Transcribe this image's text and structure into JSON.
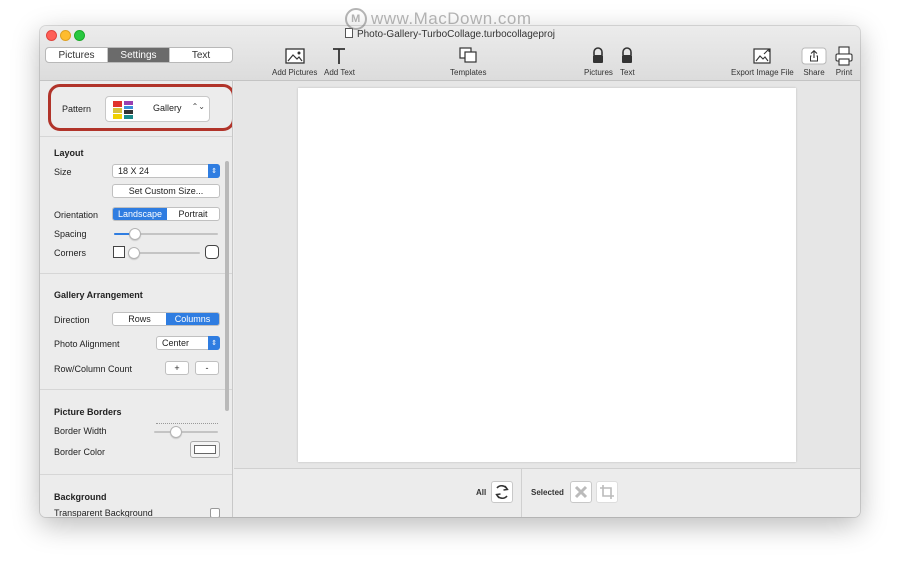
{
  "watermark": {
    "text": "www.MacDown.com",
    "logo": "M"
  },
  "window": {
    "title": "Photo-Gallery-TurboCollage.turbocollageproj"
  },
  "tabs": [
    {
      "label": "Pictures"
    },
    {
      "label": "Settings",
      "active": true
    },
    {
      "label": "Text"
    }
  ],
  "toolbar": {
    "add_pictures": "Add Pictures",
    "add_text": "Add Text",
    "templates": "Templates",
    "lock_pictures": "Pictures",
    "lock_text": "Text",
    "export": "Export Image File",
    "share": "Share",
    "print": "Print"
  },
  "pattern": {
    "label": "Pattern",
    "value": "Gallery"
  },
  "layout": {
    "title": "Layout",
    "size_label": "Size",
    "size_value": "18 X 24",
    "custom_size_button": "Set Custom Size...",
    "orientation_label": "Orientation",
    "orientation_options": [
      "Landscape",
      "Portrait"
    ],
    "orientation_selected": "Landscape",
    "spacing_label": "Spacing",
    "spacing_level": 0.2,
    "corners_label": "Corners",
    "corners_level": 0.0
  },
  "arrangement": {
    "title": "Gallery Arrangement",
    "direction_label": "Direction",
    "direction_options": [
      "Rows",
      "Columns"
    ],
    "direction_selected": "Columns",
    "alignment_label": "Photo Alignment",
    "alignment_value": "Center",
    "count_label": "Row/Column Count",
    "plus": "+",
    "minus": "-"
  },
  "borders": {
    "title": "Picture Borders",
    "width_label": "Border Width",
    "width_level": 0.35,
    "color_label": "Border Color"
  },
  "background": {
    "title": "Background",
    "transparent_label": "Transparent Background"
  },
  "bottom": {
    "all_label": "All",
    "selected_label": "Selected"
  },
  "colors": {
    "accent": "#2f7de1",
    "highlight": "#b1342a",
    "active_tab": "#6b6b6b"
  }
}
